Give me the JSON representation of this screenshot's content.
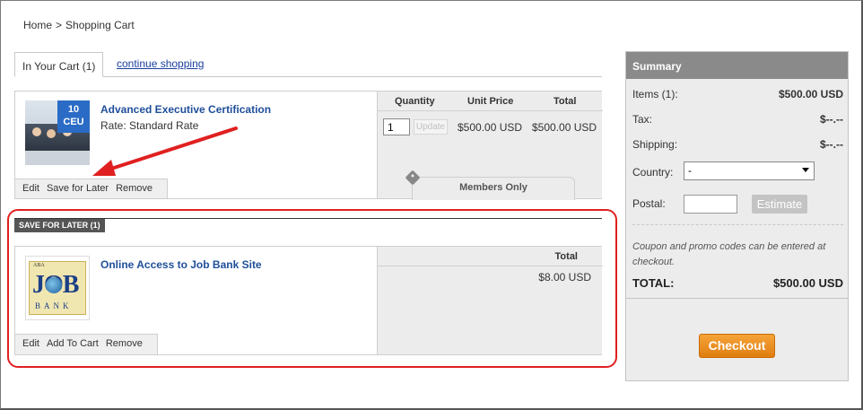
{
  "breadcrumb": {
    "home": "Home",
    "separator": ">",
    "current": "Shopping Cart"
  },
  "tabs": {
    "in_cart": "In Your Cart (1)",
    "continue": "continue shopping"
  },
  "cart": {
    "columns": {
      "quantity": "Quantity",
      "unit_price": "Unit Price",
      "total": "Total"
    },
    "item": {
      "title": "Advanced Executive Certification",
      "rate": "Rate: Standard Rate",
      "badge_line1": "10",
      "badge_line2": "CEU",
      "quantity": "1",
      "update_label": "Update",
      "unit_price": "$500.00 USD",
      "total": "$500.00 USD",
      "members_only": "Members Only",
      "actions": {
        "edit": "Edit",
        "save_for_later": "Save for Later",
        "remove": "Remove"
      }
    }
  },
  "saved": {
    "header": "SAVE FOR LATER (1)",
    "column_total": "Total",
    "item": {
      "title": "Online Access to Job Bank Site",
      "total": "$8.00 USD",
      "logo": {
        "small": "ABA",
        "word": "JOB",
        "bank": "BANK"
      },
      "actions": {
        "edit": "Edit",
        "add_to_cart": "Add To Cart",
        "remove": "Remove"
      }
    }
  },
  "summary": {
    "title": "Summary",
    "items_label": "Items (1):",
    "items_value": "$500.00 USD",
    "tax_label": "Tax:",
    "tax_value": "$--.--",
    "shipping_label": "Shipping:",
    "shipping_value": "$--.--",
    "country_label": "Country:",
    "country_value": "-",
    "postal_label": "Postal:",
    "postal_value": "",
    "estimate_label": "Estimate",
    "coupon_note": "Coupon and promo codes can be entered at checkout.",
    "total_label": "TOTAL:",
    "total_value": "$500.00 USD",
    "checkout_label": "Checkout"
  },
  "colors": {
    "link": "#1f4e9a",
    "annotation_red": "#e02020",
    "checkout_orange": "#f0901f",
    "summary_header": "#8a8a8a"
  },
  "icons": {
    "tag": "tag-icon",
    "dropdown": "chevron-down-icon",
    "annotation": "red-arrow-annotation"
  }
}
